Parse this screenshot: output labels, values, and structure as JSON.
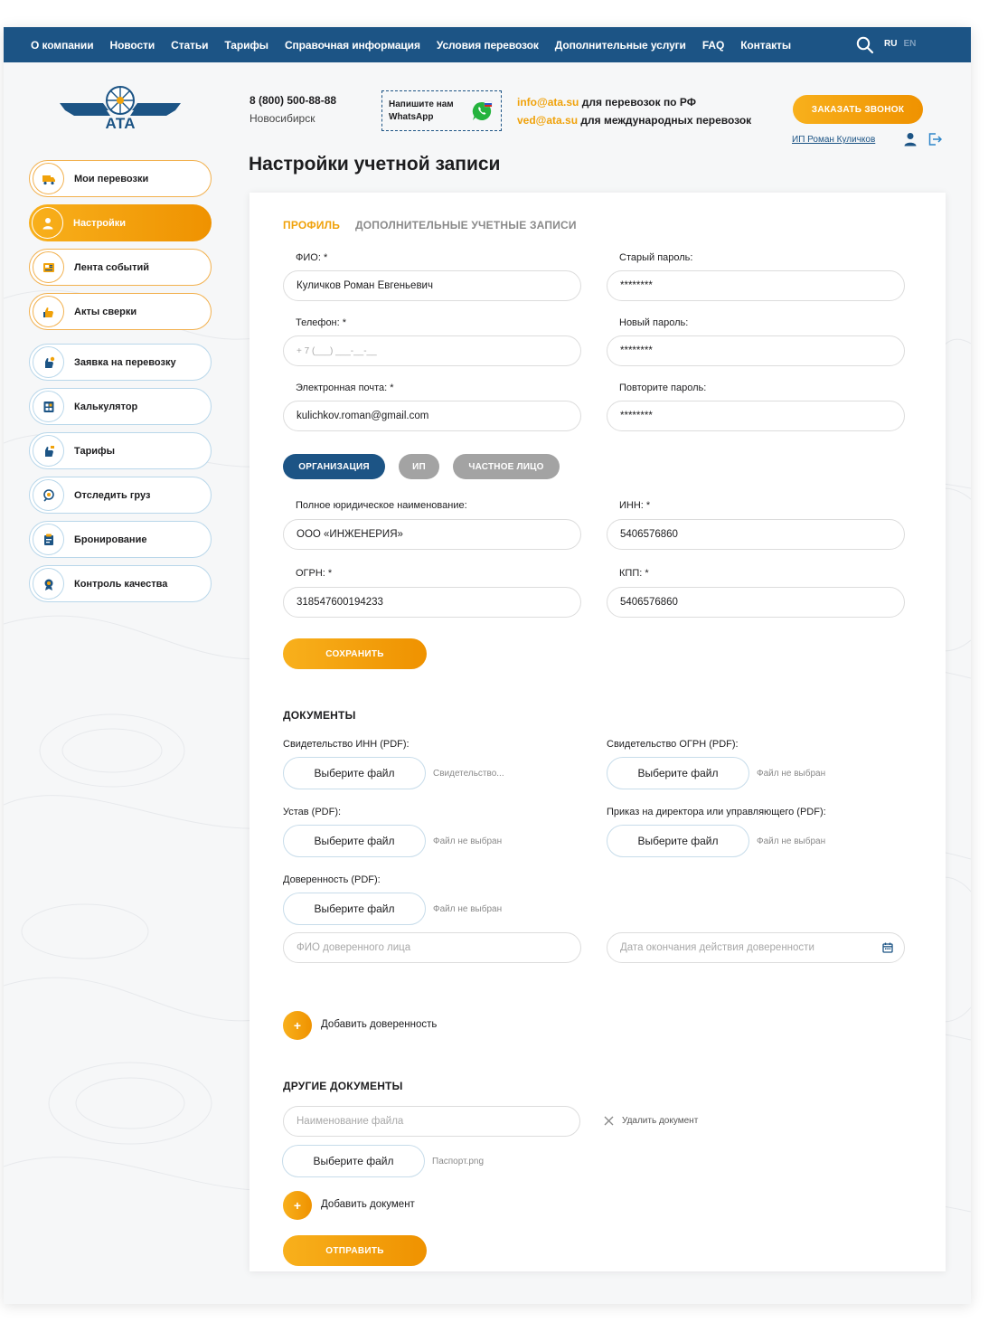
{
  "nav": {
    "items": [
      "О компании",
      "Новости",
      "Статьи",
      "Тарифы",
      "Справочная информация",
      "Условия перевозок",
      "Дополнительные услуги",
      "FAQ",
      "Контакты"
    ],
    "lang_ru": "RU",
    "lang_en": "EN"
  },
  "header": {
    "logo_text": "АТА",
    "phone": "8 (800) 500-88-88",
    "city": "Новосибирск",
    "whatsapp": "Напишите нам WhatsApp",
    "email1": "info@ata.su",
    "email1_desc": " для перевозок по РФ",
    "email2": "ved@ata.su",
    "email2_desc": " для международных перевозок",
    "call_button": "ЗАКАЗАТЬ ЗВОНОК",
    "user_name": "ИП Роман Куличков"
  },
  "page_title": "Настройки учетной записи",
  "sidebar": [
    {
      "label": "Мои перевозки",
      "icon": "truck-icon"
    },
    {
      "label": "Настройки",
      "icon": "user-icon"
    },
    {
      "label": "Лента событий",
      "icon": "feed-icon"
    },
    {
      "label": "Акты сверки",
      "icon": "hand-icon"
    },
    {
      "label": "Заявка на перевозку",
      "icon": "request-icon"
    },
    {
      "label": "Калькулятор",
      "icon": "calculator-icon"
    },
    {
      "label": "Тарифы",
      "icon": "tariff-icon"
    },
    {
      "label": "Отследить груз",
      "icon": "track-icon"
    },
    {
      "label": "Бронирование",
      "icon": "booking-icon"
    },
    {
      "label": "Контроль качества",
      "icon": "quality-icon"
    }
  ],
  "tabs": {
    "profile": "ПРОФИЛЬ",
    "extra": "ДОПОЛНИТЕЛЬНЫЕ УЧЕТНЫЕ ЗАПИСИ"
  },
  "form": {
    "fio_label": "ФИО: *",
    "fio_value": "Куличков Роман Евгеньевич",
    "phone_label": "Телефон: *",
    "phone_placeholder": "+ 7 (___) ___-__-__",
    "email_label": "Электронная почта: *",
    "email_value": "kulichkov.roman@gmail.com",
    "old_pass_label": "Старый пароль:",
    "old_pass_value": "********",
    "new_pass_label": "Новый пароль:",
    "new_pass_value": "********",
    "repeat_pass_label": "Повторите пароль:",
    "repeat_pass_value": "********",
    "type_org": "ОРГАНИЗАЦИЯ",
    "type_ip": "ИП",
    "type_private": "ЧАСТНОЕ ЛИЦО",
    "legal_name_label": "Полное юридическое наименование:",
    "legal_name_value": "ООО «ИНЖЕНЕРИЯ»",
    "inn_label": "ИНН: *",
    "inn_value": "5406576860",
    "ogrn_label": "ОГРН: *",
    "ogrn_value": "318547600194233",
    "kpp_label": "КПП: *",
    "kpp_value": "5406576860",
    "save_button": "СОХРАНИТЬ"
  },
  "documents": {
    "title": "ДОКУМЕНТЫ",
    "choose_file": "Выберите файл",
    "inn_cert_label": "Свидетельство ИНН (PDF):",
    "inn_cert_file": "Свидетельство...",
    "ogrn_cert_label": "Свидетельство ОГРН (PDF):",
    "ogrn_cert_file": "Файл не выбран",
    "charter_label": "Устав (PDF):",
    "charter_file": "Файл не выбран",
    "order_label": "Приказ на директора или управляющего (PDF):",
    "order_file": "Файл не выбран",
    "poa_label": "Доверенность (PDF):",
    "poa_file": "Файл не выбран",
    "poa_person_placeholder": "ФИО доверенного лица",
    "poa_date_placeholder": "Дата окончания действия доверенности",
    "add_poa": "Добавить доверенность",
    "plus": "+"
  },
  "other_documents": {
    "title": "ДРУГИЕ ДОКУМЕНТЫ",
    "file_name_placeholder": "Наименование файла",
    "delete": "Удалить документ",
    "choose_file": "Выберите файл",
    "file": "Паспорт.png",
    "add_doc": "Добавить документ",
    "submit": "ОТПРАВИТЬ"
  },
  "colors": {
    "primary": "#1c5485",
    "accent": "#f0a20b",
    "muted": "#a3a3a3"
  }
}
